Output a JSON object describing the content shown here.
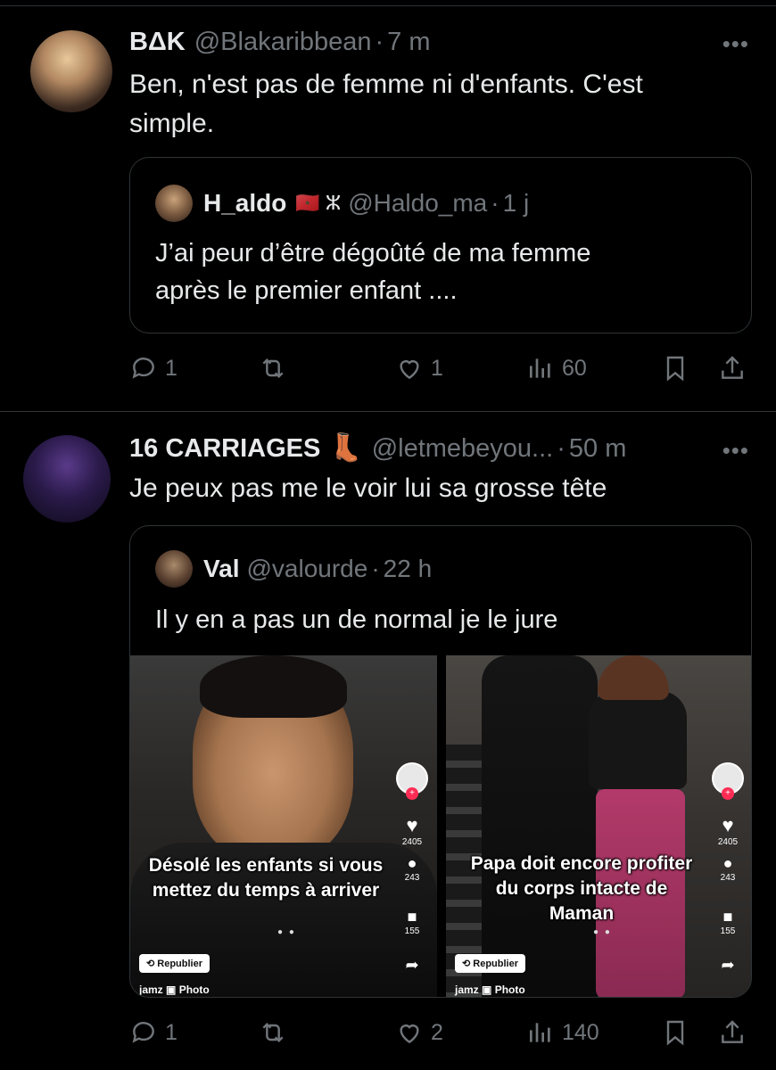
{
  "tweets": [
    {
      "author_name": "BΔK",
      "handle": "@Blakaribbean",
      "time": "7 m",
      "more": "•••",
      "text_line1": "Ben, n'est pas de femme ni d'enfants. C'est",
      "text_line2": "simple.",
      "quote": {
        "author_name": "H_aldo",
        "flags": "🇲🇦 ⵣ",
        "handle": "@Haldo_ma",
        "time": "1 j",
        "text_line1": "J’ai peur d’être dégoûté de ma femme",
        "text_line2": "après le premier enfant ...."
      },
      "actions": {
        "replies": "1",
        "reposts": "",
        "likes": "1",
        "views": "60"
      }
    },
    {
      "author_name": "16 CARRIAGES",
      "emoji": "👢",
      "handle": "@letmebeyou...",
      "time": "50 m",
      "more": "•••",
      "text_line1": "Je peux pas me le voir lui sa grosse tête",
      "quote": {
        "author_name": "Val",
        "handle": "@valourde",
        "time": "22 h",
        "text_line1": "Il y en a pas un de normal je le jure",
        "media": [
          {
            "caption_line1": "Désolé les enfants si vous",
            "caption_line2": "mettez du temps à arriver",
            "likes": "2405",
            "comments": "243",
            "saves": "155",
            "repost_label": "Republier",
            "credit": "jamz",
            "credit_type": "Photo"
          },
          {
            "caption_line1": "Papa doit encore profiter",
            "caption_line2": "du corps intacte de",
            "caption_line3": "Maman",
            "likes": "2405",
            "comments": "243",
            "saves": "155",
            "repost_label": "Republier",
            "credit": "jamz",
            "credit_type": "Photo"
          }
        ]
      },
      "actions": {
        "replies": "1",
        "reposts": "",
        "likes": "2",
        "views": "140"
      }
    }
  ],
  "colors": {
    "background": "#000000",
    "text": "#e7e9ea",
    "muted": "#71767b",
    "border": "#2f3336"
  }
}
